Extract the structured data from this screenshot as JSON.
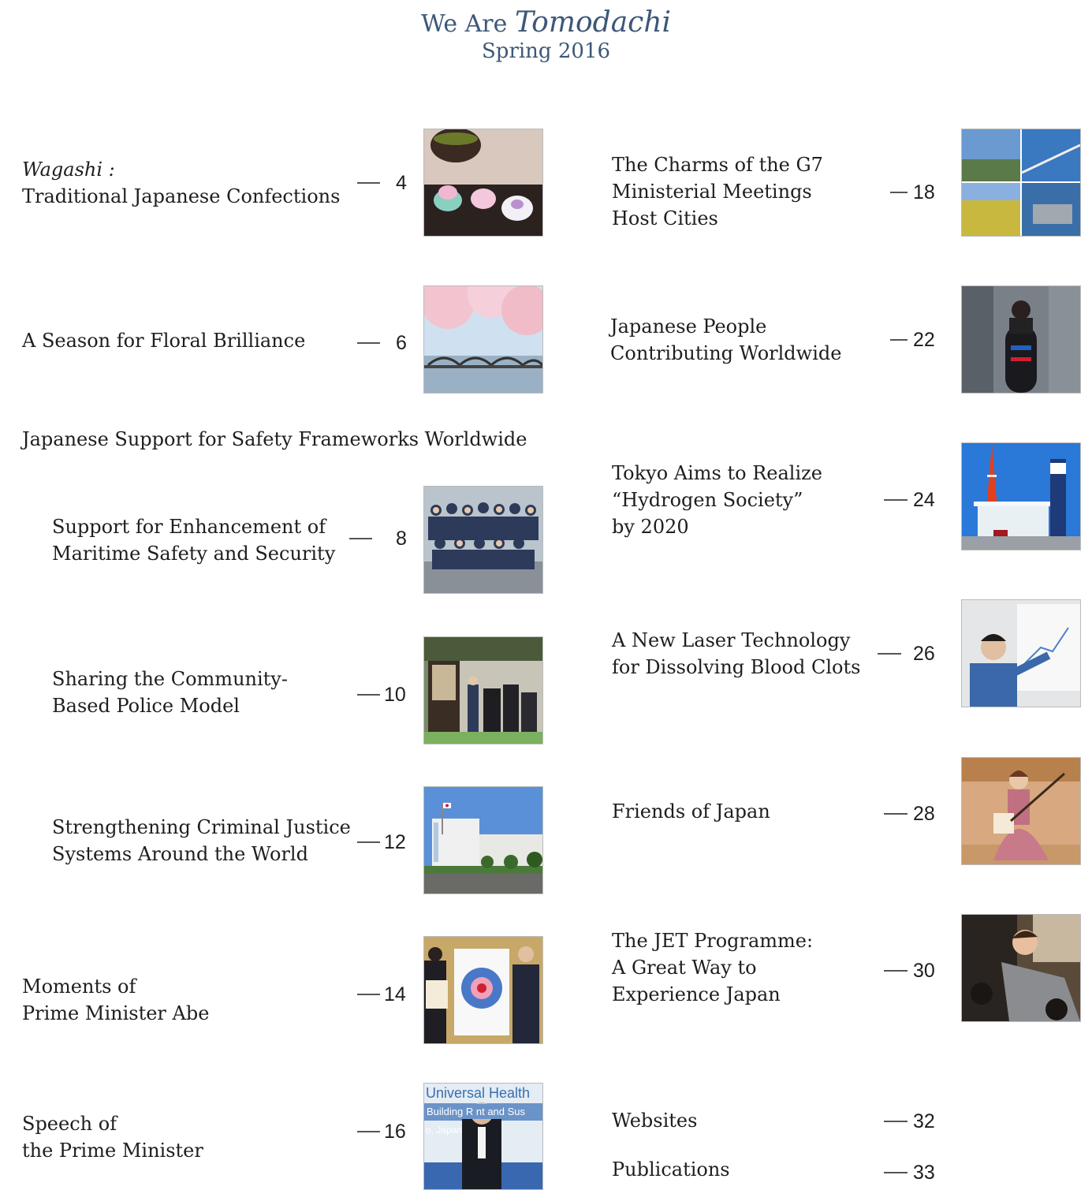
{
  "header": {
    "line1_prefix": "We Are",
    "line1_italic": "Tomodachi",
    "line2": "Spring 2016"
  },
  "left": {
    "wagashi": {
      "italic": "Wagashi :",
      "text": "Traditional Japanese Confections",
      "page": "4",
      "thumb": "wagashi-photo"
    },
    "floral": {
      "text": "A Season for Floral Brilliance",
      "page": "6",
      "thumb": "cherry-blossom-bridge-photo"
    },
    "section_heading": "Japanese Support for Safety Frameworks Worldwide",
    "maritime": {
      "line1": "Support for Enhancement of",
      "line2": "Maritime Safety and Security",
      "page": "8",
      "thumb": "maritime-group-photo"
    },
    "police": {
      "line1": "Sharing the Community-",
      "line2": "Based Police Model",
      "page": "10",
      "thumb": "koban-police-photo"
    },
    "justice": {
      "line1": "Strengthening Criminal Justice",
      "line2": "Systems Around the World",
      "page": "12",
      "thumb": "justice-building-photo"
    },
    "moments": {
      "line1": "Moments of",
      "line2": "Prime Minister Abe",
      "page": "14",
      "thumb": "prime-minister-emblem-photo"
    },
    "speech": {
      "line1": "Speech of",
      "line2": "the Prime Minister",
      "page": "16",
      "thumb": "prime-minister-speech-photo",
      "banner1": "Universal Health",
      "banner2": "Building R   nt and Sus",
      "banner3": "o, Japan"
    }
  },
  "right": {
    "g7": {
      "line1": "The Charms of the G7",
      "line2": "Ministerial Meetings",
      "line3": "Host Cities",
      "page": "18",
      "thumb": "g7-cities-collage"
    },
    "people": {
      "line1": "Japanese People",
      "line2": "Contributing Worldwide",
      "page": "22",
      "thumb": "bobsleigh-photo"
    },
    "hydrogen": {
      "line1": "Tokyo Aims to Realize",
      "line2": "“Hydrogen Society”",
      "line3": "by 2020",
      "page": "24",
      "thumb": "tokyo-tower-hydrogen-station-photo"
    },
    "laser": {
      "line1": "A New Laser Technology",
      "line2": "for Dissolving Blood Clots",
      "page": "26",
      "thumb": "laser-researcher-photo"
    },
    "friends": {
      "text": "Friends of Japan",
      "page": "28",
      "thumb": "shamisen-player-photo"
    },
    "jet": {
      "line1": "The JET Programme:",
      "line2": "A Great Way to",
      "line3": "Experience Japan",
      "page": "30",
      "thumb": "jet-teacher-photo"
    },
    "websites": {
      "text": "Websites",
      "page": "32"
    },
    "publications": {
      "text": "Publications",
      "page": "33"
    }
  },
  "colors": {
    "header": "#3d5778",
    "text": "#1e1e1e",
    "dash": "#555555"
  }
}
